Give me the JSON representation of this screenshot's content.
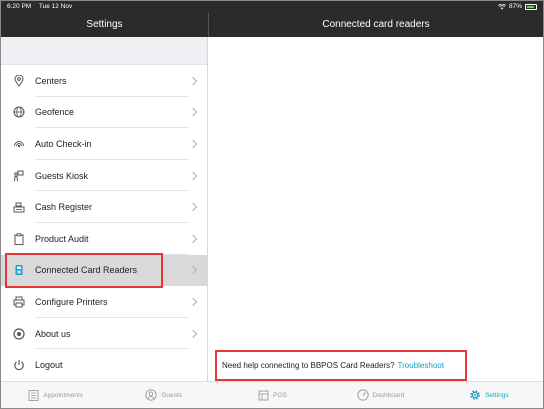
{
  "status_bar": {
    "time": "6:20 PM",
    "date": "Tue 12 Nov",
    "battery": "87%",
    "battery_level": 0.87
  },
  "header": {
    "left_title": "Settings",
    "right_title": "Connected card readers"
  },
  "sidebar": {
    "items": [
      {
        "label": "Centers",
        "icon": "location-pin-icon"
      },
      {
        "label": "Geofence",
        "icon": "globe-icon"
      },
      {
        "label": "Auto Check-in",
        "icon": "signal-icon"
      },
      {
        "label": "Guests Kiosk",
        "icon": "kiosk-icon"
      },
      {
        "label": "Cash Register",
        "icon": "cash-register-icon"
      },
      {
        "label": "Product Audit",
        "icon": "clipboard-icon"
      },
      {
        "label": "Connected Card Readers",
        "icon": "card-reader-icon",
        "selected": true
      },
      {
        "label": "Configure Printers",
        "icon": "printer-icon"
      },
      {
        "label": "About us",
        "icon": "info-icon"
      },
      {
        "label": "Logout",
        "icon": "power-icon"
      }
    ]
  },
  "content": {
    "help_text": "Need help connecting to BBPOS Card Readers?",
    "help_link": "Troubleshoot"
  },
  "tabbar": {
    "tabs": [
      {
        "label": "Appointments",
        "icon": "list-icon"
      },
      {
        "label": "Guests",
        "icon": "people-icon"
      },
      {
        "label": "POS",
        "icon": "pos-icon"
      },
      {
        "label": "Dashboard",
        "icon": "gauge-icon"
      },
      {
        "label": "Settings",
        "icon": "gear-icon",
        "active": true
      }
    ]
  },
  "colors": {
    "header_bg": "#2b2b2b",
    "accent": "#1aa0c6",
    "highlight": "#e53935",
    "selected_row": "#d9d9d9"
  }
}
